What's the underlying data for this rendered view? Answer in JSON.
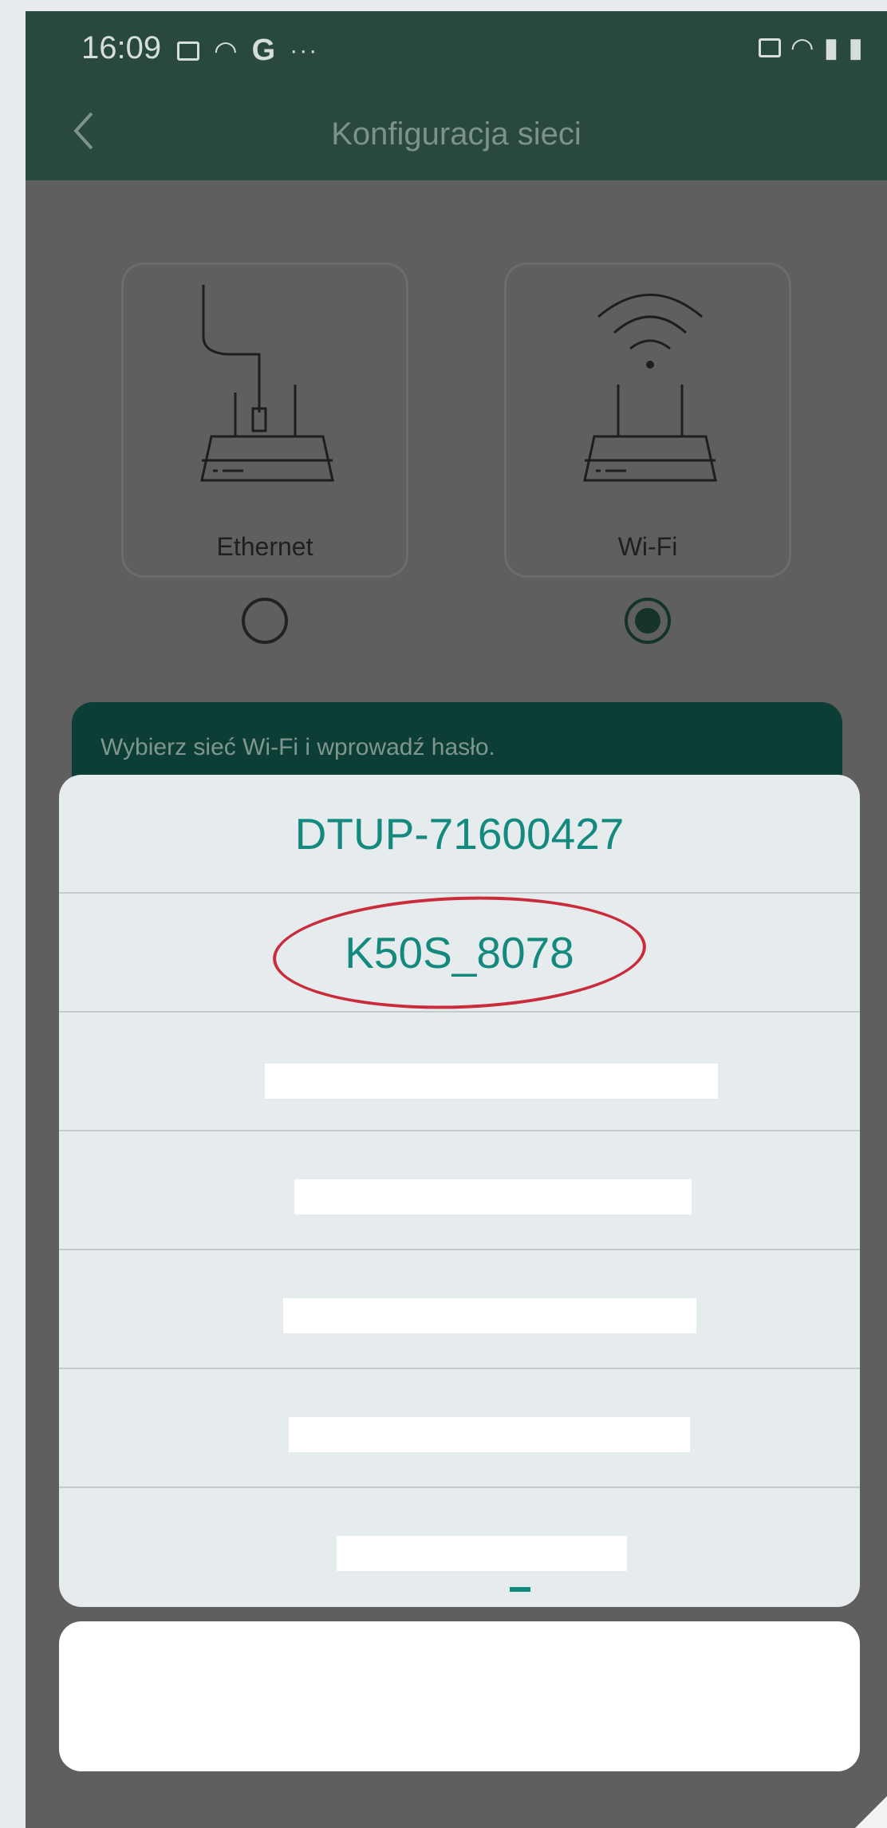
{
  "status_bar": {
    "time": "16:09"
  },
  "header": {
    "title": "Konfiguracja sieci"
  },
  "options": [
    {
      "label": "Ethernet",
      "selected": false
    },
    {
      "label": "Wi-Fi",
      "selected": true
    }
  ],
  "hint": "Wybierz sieć Wi-Fi i wprowadź hasło.",
  "network_list": [
    {
      "label": "DTUP-71600427"
    },
    {
      "label": "K50S_8078",
      "highlighted": true
    },
    {
      "label": ""
    },
    {
      "label": ""
    },
    {
      "label": ""
    },
    {
      "label": ""
    },
    {
      "label": ""
    }
  ],
  "colors": {
    "accent": "#138a7d",
    "highlight_oval": "#c92d3b",
    "header_bg": "#284840"
  }
}
